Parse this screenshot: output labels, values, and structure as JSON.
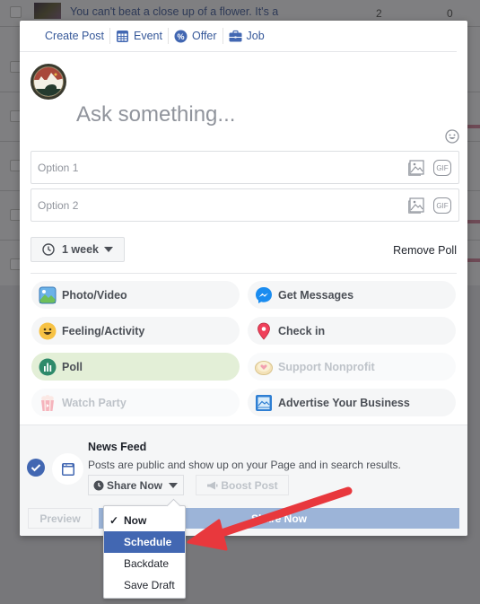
{
  "background": {
    "row_text": "You can't beat a close up of a flower. It's a",
    "row_count_1": "2",
    "row_count_2": "0"
  },
  "tabs": [
    {
      "label": "Create Post",
      "icon": "none"
    },
    {
      "label": "Event",
      "icon": "calendar-icon"
    },
    {
      "label": "Offer",
      "icon": "offer-badge-icon"
    },
    {
      "label": "Job",
      "icon": "briefcase-icon"
    }
  ],
  "composer": {
    "placeholder": "Ask something..."
  },
  "poll": {
    "options": [
      {
        "placeholder": "Option 1",
        "gif_label": "GIF"
      },
      {
        "placeholder": "Option 2",
        "gif_label": "GIF"
      }
    ],
    "duration": "1 week",
    "remove_label": "Remove Poll"
  },
  "actions": [
    {
      "label": "Photo/Video",
      "icon": "photo-icon",
      "state": "normal"
    },
    {
      "label": "Get Messages",
      "icon": "messenger-icon",
      "state": "normal"
    },
    {
      "label": "Feeling/Activity",
      "icon": "smiley-icon",
      "state": "normal"
    },
    {
      "label": "Check in",
      "icon": "location-pin-icon",
      "state": "normal"
    },
    {
      "label": "Poll",
      "icon": "poll-icon",
      "state": "active"
    },
    {
      "label": "Support Nonprofit",
      "icon": "nonprofit-heart-icon",
      "state": "disabled"
    },
    {
      "label": "Watch Party",
      "icon": "popcorn-icon",
      "state": "disabled"
    },
    {
      "label": "Advertise Your Business",
      "icon": "advertise-icon",
      "state": "normal"
    }
  ],
  "footer": {
    "destination_title": "News Feed",
    "destination_desc": "Posts are public and show up on your Page and in search results.",
    "share_timing": "Share Now",
    "boost_label": "Boost Post",
    "preview_label": "Preview",
    "share_button_label": "Share Now"
  },
  "dropdown": {
    "items": [
      {
        "label": "Now",
        "checked": true
      },
      {
        "label": "Schedule",
        "highlighted": true
      },
      {
        "label": "Backdate"
      },
      {
        "label": "Save Draft"
      }
    ]
  },
  "colors": {
    "brand_blue": "#4267b2",
    "link_blue": "#365899",
    "annotation_arrow": "#e8383d",
    "poll_active_bg": "#e3efd7"
  }
}
